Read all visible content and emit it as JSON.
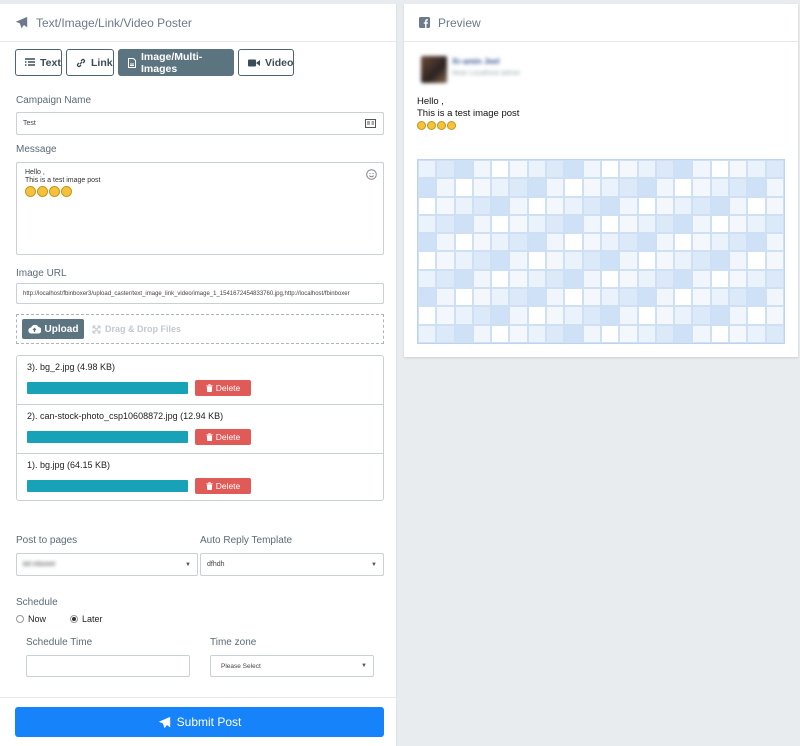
{
  "left_panel": {
    "title": "Text/Image/Link/Video Poster",
    "tabs": [
      {
        "label": "Text",
        "icon": "text-icon"
      },
      {
        "label": "Link",
        "icon": "link-icon"
      },
      {
        "label": "Image/Multi-Images",
        "icon": "image-file-icon",
        "active": true
      },
      {
        "label": "Video",
        "icon": "video-icon"
      }
    ],
    "campaign_name": {
      "label": "Campaign Name",
      "value": "Test"
    },
    "message": {
      "label": "Message",
      "lines": [
        "Hello ,",
        "This is a test image post"
      ],
      "emoji_count": 4
    },
    "image_url": {
      "label": "Image URL",
      "value": "http://localhost/fbinboxer3/upload_caster/text_image_link_video/image_1_1541672454833760.jpg,http://localhost/fbinboxer"
    },
    "upload": {
      "button_label": "Upload",
      "drag_drop_label": "Drag & Drop Files"
    },
    "files": [
      {
        "name": "3). bg_2.jpg (4.98 KB)",
        "progress": 1.0,
        "delete_label": "Delete"
      },
      {
        "name": "2). can-stock-photo_csp10608872.jpg (12.94 KB)",
        "progress": 1.0,
        "delete_label": "Delete"
      },
      {
        "name": "1). bg.jpg (64.15 KB)",
        "progress": 1.0,
        "delete_label": "Delete"
      }
    ],
    "post_to_pages": {
      "label": "Post to pages",
      "value": "bd inboxer"
    },
    "auto_reply": {
      "label": "Auto Reply Template",
      "value": "dfhdh"
    },
    "schedule": {
      "label": "Schedule",
      "options": [
        {
          "label": "Now",
          "checked": false
        },
        {
          "label": "Later",
          "checked": true
        }
      ],
      "time_label": "Schedule Time",
      "time_value": "",
      "timezone_label": "Time zone",
      "timezone_value": "Please Select"
    },
    "submit_label": "Submit Post"
  },
  "preview_panel": {
    "title": "Preview",
    "page_name": "Xr-amin Jeel",
    "page_sub": "Near Localhost admin",
    "post_lines": [
      "Hello ,",
      "This is a test image post"
    ],
    "emoji_count": 4
  },
  "colors": {
    "accent": "#5c7380",
    "submit": "#1683fb",
    "progress": "#17a2b8",
    "delete": "#e05a58"
  }
}
